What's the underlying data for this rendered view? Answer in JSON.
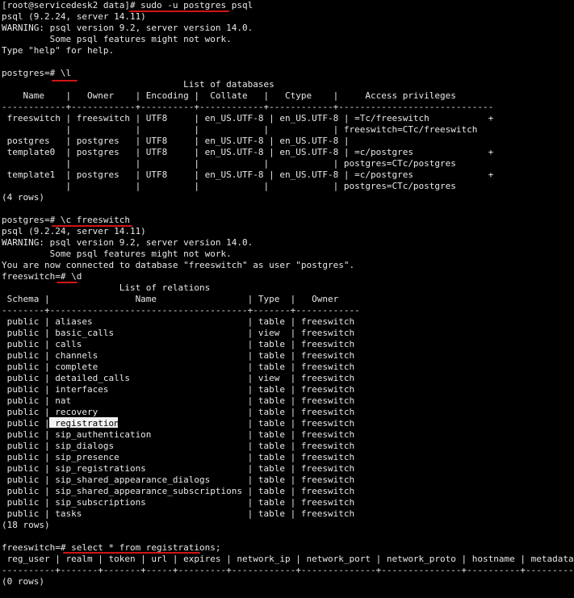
{
  "terminal": {
    "lines": [
      "[root@servicedesk2 data]# sudo -u postgres psql",
      "psql (9.2.24, server 14.11)",
      "WARNING: psql version 9.2, server version 14.0.",
      "         Some psql features might not work.",
      "Type \"help\" for help.",
      "",
      "postgres=# \\l",
      "                                  List of databases",
      "    Name    |   Owner    | Encoding |  Collate   |   Ctype    |     Access privileges",
      "------------+------------+----------+------------+------------+-----------------------------",
      " freeswitch | freeswitch | UTF8     | en_US.UTF-8 | en_US.UTF-8 | =Tc/freeswitch           +",
      "            |            |          |            |            | freeswitch=CTc/freeswitch",
      " postgres   | postgres   | UTF8     | en_US.UTF-8 | en_US.UTF-8 |",
      " template0  | postgres   | UTF8     | en_US.UTF-8 | en_US.UTF-8 | =c/postgres              +",
      "            |            |          |            |            | postgres=CTc/postgres",
      " template1  | postgres   | UTF8     | en_US.UTF-8 | en_US.UTF-8 | =c/postgres              +",
      "            |            |          |            |            | postgres=CTc/postgres",
      "(4 rows)",
      "",
      "postgres=# \\c freeswitch",
      "psql (9.2.24, server 14.11)",
      "WARNING: psql version 9.2, server version 14.0.",
      "         Some psql features might not work.",
      "You are now connected to database \"freeswitch\" as user \"postgres\".",
      "freeswitch=# \\d",
      "                      List of relations",
      " Schema |                Name                 | Type  |   Owner",
      "--------+-------------------------------------+-------+------------",
      " public | aliases                             | table | freeswitch",
      " public | basic_calls                         | view  | freeswitch",
      " public | calls                               | table | freeswitch",
      " public | channels                            | table | freeswitch",
      " public | complete                            | table | freeswitch",
      " public | detailed_calls                      | view  | freeswitch",
      " public | interfaces                          | table | freeswitch",
      " public | nat                                 | table | freeswitch",
      " public | recovery                            | table | freeswitch",
      " public | registrations                       | table | freeswitch",
      " public | sip_authentication                  | table | freeswitch",
      " public | sip_dialogs                         | table | freeswitch",
      " public | sip_presence                        | table | freeswitch",
      " public | sip_registrations                   | table | freeswitch",
      " public | sip_shared_appearance_dialogs       | table | freeswitch",
      " public | sip_shared_appearance_subscriptions | table | freeswitch",
      " public | sip_subscriptions                   | table | freeswitch",
      " public | tasks                               | table | freeswitch",
      "(18 rows)",
      "",
      "freeswitch=# select * from registrations;",
      " reg_user | realm | token | url | expires | network_ip | network_port | network_proto | hostname | metadata",
      "----------+-------+-------+-----+---------+------------+--------------+---------------+----------+----------",
      "(0 rows)"
    ],
    "highlighted_word": "registrations"
  }
}
